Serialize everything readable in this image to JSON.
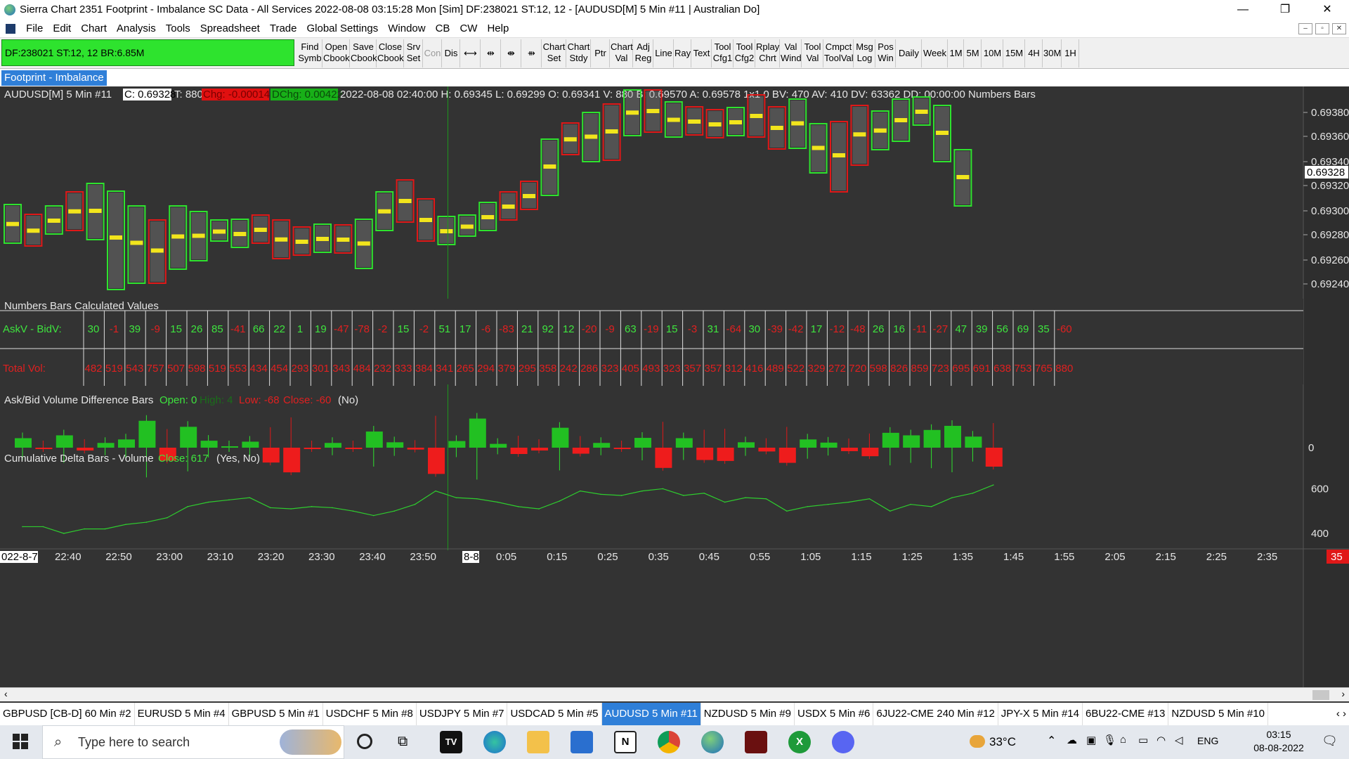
{
  "window": {
    "title": "Sierra Chart 2351 Footprint - Imbalance  SC Data - All Services 2022-08-08  03:15:28 Mon [Sim]  DF:238021  ST:12, 12  - [AUDUSD[M]  5 Min  #11 | Australian Do]",
    "minimize": "—",
    "maximize": "❐",
    "close": "✕"
  },
  "menu": {
    "items": [
      "File",
      "Edit",
      "Chart",
      "Analysis",
      "Tools",
      "Spreadsheet",
      "Trade",
      "Global Settings",
      "Window",
      "CB",
      "CW",
      "Help"
    ],
    "mdi_buttons": [
      "–",
      "▫",
      "✕"
    ]
  },
  "toolbar": {
    "status": "DF:238021  ST:12, 12  BR:6.85M",
    "buttons": [
      {
        "l1": "Find",
        "l2": "Symb"
      },
      {
        "l1": "Open",
        "l2": "Cbook"
      },
      {
        "l1": "Save",
        "l2": "Cbook"
      },
      {
        "l1": "Close",
        "l2": "Cbook"
      },
      {
        "l1": "Srv",
        "l2": "Set"
      },
      {
        "l1": "Con",
        "l2": ""
      },
      {
        "l1": "Dis",
        "l2": ""
      },
      {
        "l1": "⟷",
        "l2": ""
      },
      {
        "l1": "⇹",
        "l2": ""
      },
      {
        "l1": "⇼",
        "l2": ""
      },
      {
        "l1": "⇻",
        "l2": ""
      },
      {
        "l1": "Chart",
        "l2": "Set"
      },
      {
        "l1": "Chart",
        "l2": "Stdy"
      },
      {
        "l1": "Ptr",
        "l2": ""
      },
      {
        "l1": "Chart",
        "l2": "Val"
      },
      {
        "l1": "Adj",
        "l2": "Reg"
      },
      {
        "l1": "Line",
        "l2": ""
      },
      {
        "l1": "Ray",
        "l2": ""
      },
      {
        "l1": "Text",
        "l2": ""
      },
      {
        "l1": "Tool",
        "l2": "Cfg1"
      },
      {
        "l1": "Tool",
        "l2": "Cfg2"
      },
      {
        "l1": "Rplay",
        "l2": "Chrt"
      },
      {
        "l1": "Val",
        "l2": "Wind"
      },
      {
        "l1": "Tool",
        "l2": "Val"
      },
      {
        "l1": "Cmpct",
        "l2": "ToolVal"
      },
      {
        "l1": "Msg",
        "l2": "Log"
      },
      {
        "l1": "Pos",
        "l2": "Win"
      },
      {
        "l1": "Daily",
        "l2": ""
      },
      {
        "l1": "Week",
        "l2": ""
      },
      {
        "l1": "1M",
        "l2": ""
      },
      {
        "l1": "5M",
        "l2": ""
      },
      {
        "l1": "10M",
        "l2": ""
      },
      {
        "l1": "15M",
        "l2": ""
      },
      {
        "l1": "4H",
        "l2": ""
      },
      {
        "l1": "30M",
        "l2": ""
      },
      {
        "l1": "1H",
        "l2": ""
      }
    ]
  },
  "study_tab": "Footprint - Imbalance",
  "chart": {
    "symbol_header": {
      "symbol": "AUDUSD[M]  5 Min   #11",
      "close_box": "C: 0.69328",
      "t": "T: 880",
      "chg": "Chg: -0.00014",
      "dchg": "DChg: 0.00422",
      "rest": "2022-08-08 02:40:00 H: 0.69345 L: 0.69299 O: 0.69341 V: 880 B: 0.69570 A: 0.69578 1x1 0 BV: 470 AV: 410 DV: 63362 DD: 00:00:00 Numbers Bars"
    },
    "price_scale": [
      "0.69380",
      "0.69360",
      "0.69340",
      "0.69320",
      "0.69300",
      "0.69280",
      "0.69260",
      "0.69240"
    ],
    "current_price": "0.69328",
    "numbers_panel_title": "Numbers Bars Calculated Values",
    "row1_label": "AskV - BidV:",
    "row2_label": "Total Vol:",
    "askbid_title": "Ask/Bid Volume Difference Bars",
    "askbid_open": "Open: 0",
    "askbid_high": "High: 4",
    "askbid_low": "Low: -68",
    "askbid_close": "Close: -60",
    "askbid_flag": "(No)",
    "askbid_scale": "0",
    "cumdelta_title": "Cumulative Delta Bars - Volume",
    "cumdelta_close": "Close: 617",
    "cumdelta_flags": "(Yes, No)",
    "cumdelta_scale": [
      "600",
      "400"
    ],
    "time_axis": [
      "022-8-7",
      "22:40",
      "22:50",
      "23:00",
      "23:10",
      "23:20",
      "23:30",
      "23:40",
      "23:50",
      "8-8",
      "0:05",
      "0:15",
      "0:25",
      "0:35",
      "0:45",
      "0:55",
      "1:05",
      "1:15",
      "1:25",
      "1:35",
      "1:45",
      "1:55",
      "2:05",
      "2:15",
      "2:25",
      "2:35"
    ],
    "corner_badge": "35"
  },
  "chart_data": [
    {
      "type": "table",
      "title": "Numbers Bars Calculated Values",
      "rows": [
        "AskV - BidV:",
        "Total Vol:"
      ],
      "askv_bidv": [
        30,
        -1,
        39,
        -9,
        15,
        26,
        85,
        -41,
        66,
        22,
        1,
        19,
        -47,
        -78,
        -2,
        15,
        -2,
        51,
        17,
        -6,
        -83,
        21,
        92,
        12,
        -20,
        -9,
        63,
        -19,
        15,
        -3,
        31,
        -64,
        30,
        -39,
        -42,
        17,
        -12,
        -48,
        26,
        16,
        -11,
        -27,
        47,
        39,
        56,
        69,
        35,
        -60
      ],
      "total_vol": [
        482,
        519,
        543,
        757,
        507,
        598,
        519,
        553,
        434,
        454,
        293,
        301,
        343,
        484,
        232,
        333,
        384,
        341,
        265,
        294,
        379,
        295,
        358,
        242,
        286,
        323,
        405,
        493,
        323,
        357,
        357,
        312,
        416,
        489,
        522,
        329,
        272,
        720,
        598,
        826,
        859,
        723,
        695,
        691,
        638,
        753,
        765,
        880
      ]
    },
    {
      "type": "line",
      "title": "Cumulative Delta Bars - Volume",
      "ylim": [
        340,
        740
      ],
      "values": [
        430,
        430,
        400,
        420,
        420,
        440,
        450,
        470,
        520,
        540,
        550,
        560,
        515,
        510,
        520,
        515,
        500,
        480,
        500,
        530,
        590,
        560,
        555,
        540,
        520,
        510,
        545,
        590,
        575,
        570,
        590,
        600,
        570,
        580,
        540,
        560,
        555,
        500,
        520,
        530,
        540,
        555,
        500,
        530,
        520,
        560,
        580,
        617
      ]
    },
    {
      "type": "bar",
      "title": "Ask/Bid Volume Difference Bars",
      "values": [
        30,
        -1,
        39,
        -9,
        15,
        26,
        85,
        -41,
        66,
        22,
        1,
        19,
        -47,
        -78,
        -2,
        15,
        -2,
        51,
        17,
        -6,
        -83,
        21,
        92,
        12,
        -20,
        -9,
        63,
        -19,
        15,
        -3,
        31,
        -64,
        30,
        -39,
        -42,
        17,
        -12,
        -48,
        26,
        16,
        -11,
        -27,
        47,
        39,
        56,
        69,
        35,
        -60
      ]
    }
  ],
  "symbol_tabs": [
    {
      "label": "GBPUSD [CB-D]  60 Min  #2",
      "sel": false
    },
    {
      "label": "EURUSD  5 Min  #4",
      "sel": false
    },
    {
      "label": "GBPUSD  5 Min  #1",
      "sel": false
    },
    {
      "label": "USDCHF  5 Min  #8",
      "sel": false
    },
    {
      "label": "USDJPY  5 Min  #7",
      "sel": false
    },
    {
      "label": "USDCAD  5 Min  #5",
      "sel": false
    },
    {
      "label": "AUDUSD  5 Min  #11",
      "sel": true
    },
    {
      "label": "NZDUSD  5 Min  #9",
      "sel": false
    },
    {
      "label": "USDX  5 Min  #6",
      "sel": false
    },
    {
      "label": "6JU22-CME  240 Min  #12",
      "sel": false
    },
    {
      "label": "JPY-X  5 Min  #14",
      "sel": false
    },
    {
      "label": "6BU22-CME  #13",
      "sel": false
    },
    {
      "label": "NZDUSD  5 Min  #10",
      "sel": false
    }
  ],
  "taskbar": {
    "search_placeholder": "Type here to search",
    "temperature": "33°C",
    "lang": "ENG",
    "time": "03:15",
    "date": "08-08-2022"
  }
}
